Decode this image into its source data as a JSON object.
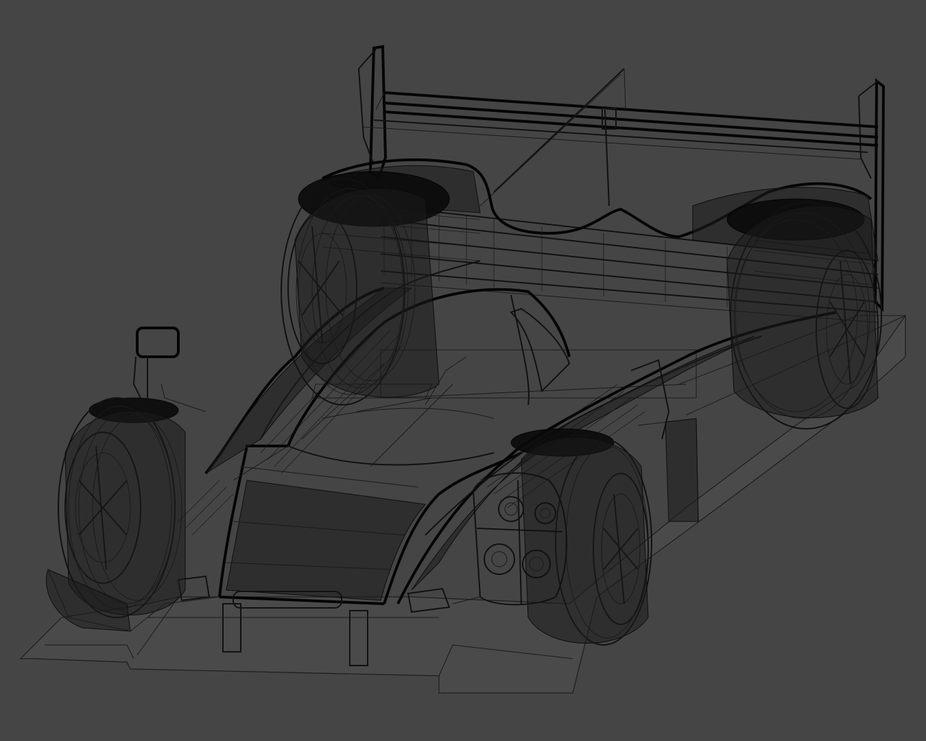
{
  "viewport": {
    "background": "#454545",
    "wire_color": "#0a0a0a",
    "render_mode": "wireframe"
  },
  "model": {
    "subject": "le-mans-prototype-race-car",
    "view": "front-three-quarter-perspective"
  }
}
